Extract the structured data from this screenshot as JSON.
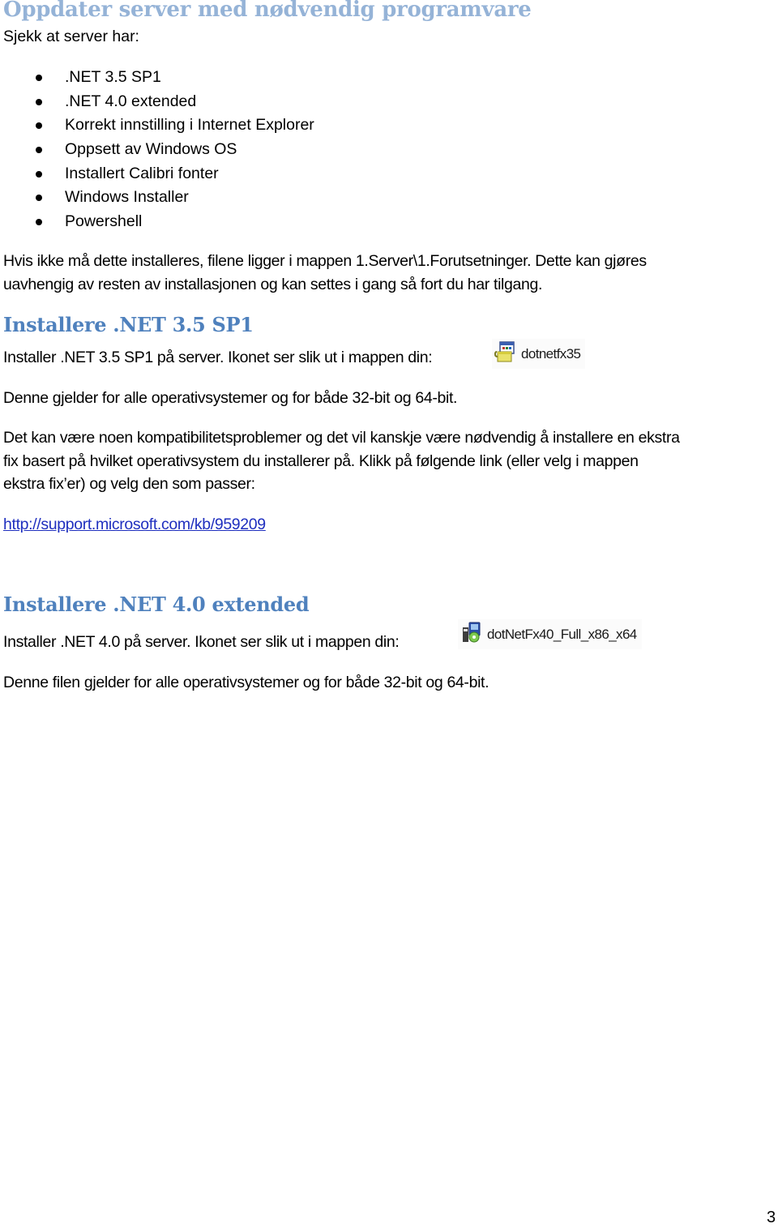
{
  "page": {
    "number": "3"
  },
  "section_prereq": {
    "heading": "Oppdater server med nødvendig programvare",
    "intro": "Sjekk at server har:",
    "checklist": [
      ".NET 3.5 SP1",
      ".NET 4.0 extended",
      "Korrekt innstilling i Internet Explorer",
      "Oppsett av Windows OS",
      "Installert Calibri fonter",
      "Windows Installer",
      "Powershell"
    ],
    "note_line1": "Hvis ikke må dette installeres, filene ligger i mappen 1.Server\\1.Forutsetninger. Dette kan gjøres",
    "note_line2": "uavhengig av resten av installasjonen og kan settes i gang så fort du har tilgang."
  },
  "section_net35": {
    "heading": "Installere .NET 3.5 SP1",
    "instruction": "Installer .NET 3.5 SP1 på server. Ikonet ser slik ut i mappen din:",
    "file_icon": "installer-package-icon",
    "file_name": "dotnetfx35",
    "applies_to": "Denne gjelder for alle operativsystemer og for både 32-bit og 64-bit.",
    "compat_line1": "Det kan være noen kompatibilitetsproblemer og det vil kanskje være nødvendig å installere en ekstra",
    "compat_line2": "fix basert på hvilket operativsystem du installerer på. Klikk på følgende link (eller velg i mappen",
    "compat_line3": "ekstra fix’er) og velg den som passer:",
    "link": "http://support.microsoft.com/kb/959209"
  },
  "section_net40": {
    "heading": "Installere .NET 4.0 extended",
    "instruction": "Installer .NET 4.0 på server. Ikonet ser slik ut i mappen din:",
    "file_icon": "setup-program-icon",
    "file_name": "dotNetFx40_Full_x86_x64",
    "applies_to": "Denne filen gjelder for alle operativsystemer og for både 32-bit og 64-bit."
  },
  "colors": {
    "heading1": "#95b3d7",
    "heading2": "#4f81bd",
    "link": "#1f2fbf",
    "text": "#000000"
  }
}
